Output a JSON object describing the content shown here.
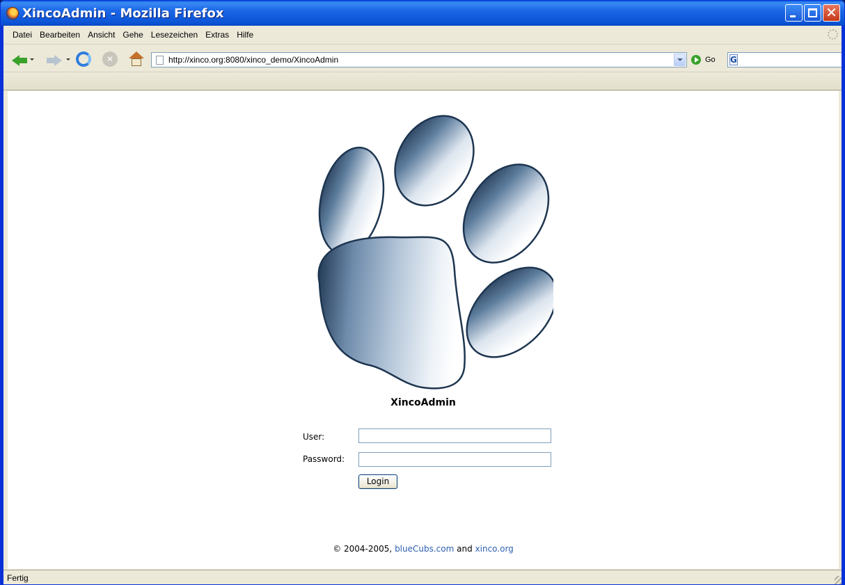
{
  "window": {
    "title": "XincoAdmin - Mozilla Firefox"
  },
  "menu": {
    "items": [
      "Datei",
      "Bearbeiten",
      "Ansicht",
      "Gehe",
      "Lesezeichen",
      "Extras",
      "Hilfe"
    ]
  },
  "navigation": {
    "url": "http://xinco.org:8080/xinco_demo/XincoAdmin",
    "go_label": "Go",
    "search_engine_label": "G",
    "search_value": ""
  },
  "page": {
    "app_title": "XincoAdmin",
    "user_label": "User:",
    "user_value": "",
    "password_label": "Password:",
    "password_value": "",
    "login_label": "Login",
    "footer": {
      "prefix": "© 2004-2005, ",
      "link1": "blueCubs.com",
      "middle": " and ",
      "link2": "xinco.org"
    },
    "logo_icon": "paw-print-icon"
  },
  "status": {
    "text": "Fertig"
  },
  "colors": {
    "titlebar": "#0a5bde",
    "link": "#2a5fb0",
    "paw": "#1d3550"
  }
}
